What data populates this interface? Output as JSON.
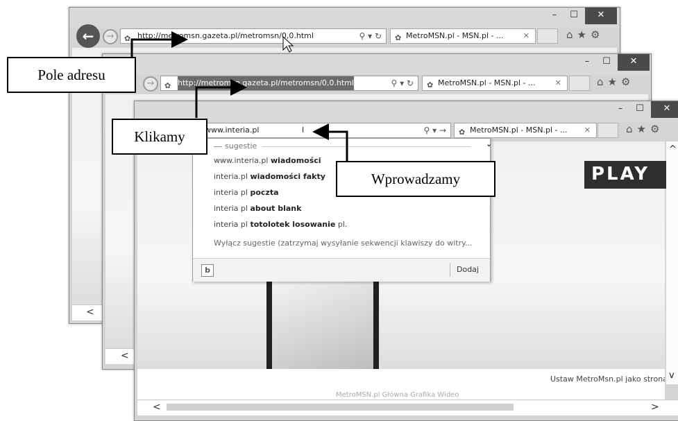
{
  "window_controls": {
    "minimize": "–",
    "maximize": "☐",
    "close": "✕"
  },
  "win1": {
    "address": "http://metromsn.gazeta.pl/metromsn/0,0.html",
    "address_actions": "⚲ ▾ ↻",
    "tab_title": "MetroMSN.pl - MSN.pl - ...",
    "tab_close": "✕",
    "scroll_left": "<"
  },
  "win2": {
    "address": "http://metromsn.gazeta.pl/metromsn/0,0.html",
    "address_actions": "⚲ ▾ ↻",
    "tab_title": "MetroMSN.pl - MSN.pl - ...",
    "tab_close": "✕",
    "scroll_left": "<"
  },
  "win3": {
    "address": "www.interia.pl",
    "address_actions": "⚲ ▾ →",
    "tab_title": "MetroMSN.pl - MSN.pl - ...",
    "tab_close": "✕",
    "brand_banner": "PLAY",
    "homepage_link": "Ustaw MetroMsn.pl jako stroną startową",
    "footer_partial": "MetroMSN.pl Główna Grafika Wideo",
    "scroll_left": "<",
    "scroll_right": ">",
    "scroll_up": "^",
    "scroll_down": "v"
  },
  "dropdown": {
    "header": "sugestie",
    "collapse": "⌄",
    "suggestions": [
      {
        "prefix": "www.interia.pl ",
        "bold": "wiadomości",
        "suffix": ""
      },
      {
        "prefix": "interia.pl ",
        "bold": "wiadomości fakty",
        "suffix": ""
      },
      {
        "prefix": "interia pl ",
        "bold": "poczta",
        "suffix": ""
      },
      {
        "prefix": "interia pl ",
        "bold": "about blank",
        "suffix": ""
      },
      {
        "prefix": "interia pl ",
        "bold": "totolotek losowanie",
        "suffix": " pl."
      }
    ],
    "disable_text": "Wyłącz sugestie (zatrzymaj wysyłanie sekwencji klawiszy do witry...",
    "bing_label": "b",
    "add_button": "Dodaj"
  },
  "callouts": {
    "address_bar": "Pole adresu",
    "click": "Klikamy",
    "enter": "Wprowadzamy"
  },
  "icons": {
    "back": "back-arrow-icon",
    "forward": "forward-arrow-icon",
    "home": "home-icon",
    "favorites": "star-icon",
    "settings": "gear-icon",
    "search": "search-icon",
    "refresh": "refresh-icon",
    "favicon": "msn-butterfly-icon",
    "bing": "bing-logo-icon"
  }
}
